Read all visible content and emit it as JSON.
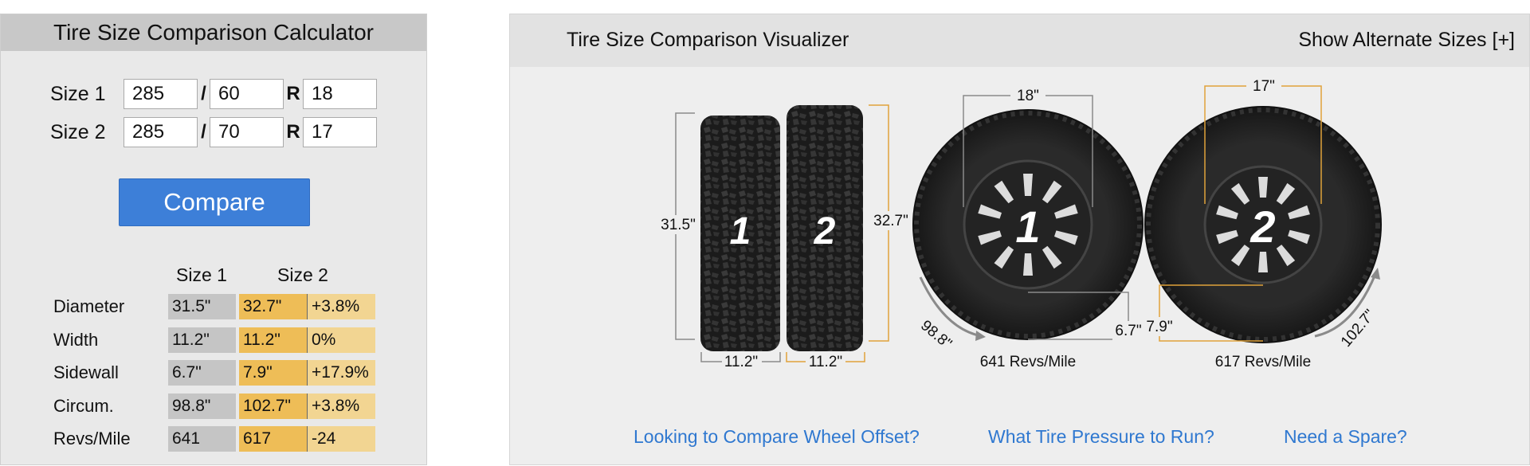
{
  "calculator": {
    "title": "Tire Size Comparison Calculator",
    "size1": {
      "label": "Size 1",
      "width": "285",
      "aspect": "60",
      "rim": "18"
    },
    "size2": {
      "label": "Size 2",
      "width": "285",
      "aspect": "70",
      "rim": "17"
    },
    "slash": "/",
    "r": "R",
    "compare_label": "Compare",
    "results": {
      "col1": "Size 1",
      "col2": "Size 2",
      "rows": [
        {
          "label": "Diameter",
          "v1": "31.5\"",
          "v2": "32.7\"",
          "diff": "+3.8%"
        },
        {
          "label": "Width",
          "v1": "11.2\"",
          "v2": "11.2\"",
          "diff": "0%"
        },
        {
          "label": "Sidewall",
          "v1": "6.7\"",
          "v2": "7.9\"",
          "diff": "+17.9%"
        },
        {
          "label": "Circum.",
          "v1": "98.8\"",
          "v2": "102.7\"",
          "diff": "+3.8%"
        },
        {
          "label": "Revs/Mile",
          "v1": "641",
          "v2": "617",
          "diff": "-24"
        }
      ]
    }
  },
  "visualizer": {
    "title": "Tire Size Comparison Visualizer",
    "alt_sizes_label": "Show Alternate Sizes [+]",
    "tread1": {
      "number": "1",
      "diameter": "31.5\"",
      "width": "11.2\""
    },
    "tread2": {
      "number": "2",
      "diameter": "32.7\"",
      "width": "11.2\""
    },
    "wheel1": {
      "number": "1",
      "rim": "18\"",
      "sidewall": "6.7\"",
      "circumference": "98.8\"",
      "revs": "641 Revs/Mile"
    },
    "wheel2": {
      "number": "2",
      "rim": "17\"",
      "sidewall": "7.9\"",
      "circumference": "102.7\"",
      "revs": "617 Revs/Mile"
    },
    "links": {
      "offset": "Looking to Compare Wheel Offset?",
      "pressure": "What Tire Pressure to Run?",
      "spare": "Need a Spare?"
    },
    "colors": {
      "size1_line": "#8a8a8a",
      "size2_line": "#e0a23a",
      "link": "#2f78d0",
      "button": "#3d7fd8"
    }
  }
}
